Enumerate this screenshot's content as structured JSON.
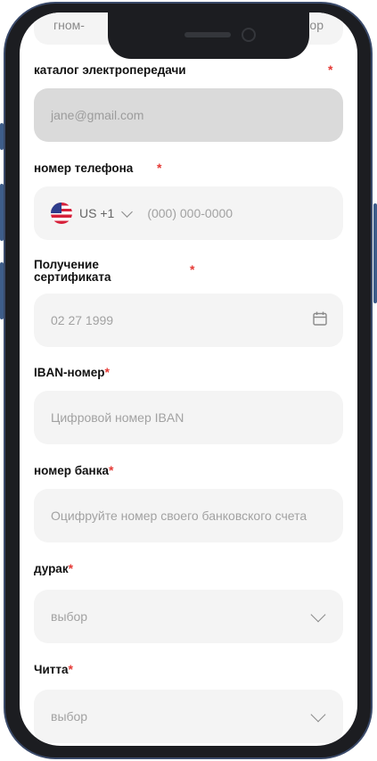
{
  "top_field": {
    "left": "гном-",
    "right": "ор"
  },
  "fields": {
    "transmission_catalog": {
      "label": "каталог электропередачи",
      "star": "*",
      "value": "jane@gmail.com"
    },
    "phone": {
      "label": "номер телефона",
      "star": "*",
      "country": "US +1",
      "placeholder": "(000) 000-0000"
    },
    "certificate": {
      "label": "Получение сертификата",
      "star": "*",
      "placeholder": "02 27 1999"
    },
    "iban": {
      "label": "IBAN-номер",
      "star": "*",
      "placeholder": "Цифровой номер IBAN"
    },
    "bank": {
      "label": "номер банка",
      "star": "*",
      "placeholder": "Оцифруйте номер своего банковского счета"
    },
    "select1": {
      "label": "дурак",
      "star": "*",
      "placeholder": "выбор"
    },
    "select2": {
      "label": "Читта",
      "star": "*",
      "placeholder": "выбор"
    }
  },
  "colors": {
    "required": "#e53935",
    "field_bg": "#f4f4f4",
    "field_filled_bg": "#dadada",
    "frame": "#1c1d21"
  }
}
